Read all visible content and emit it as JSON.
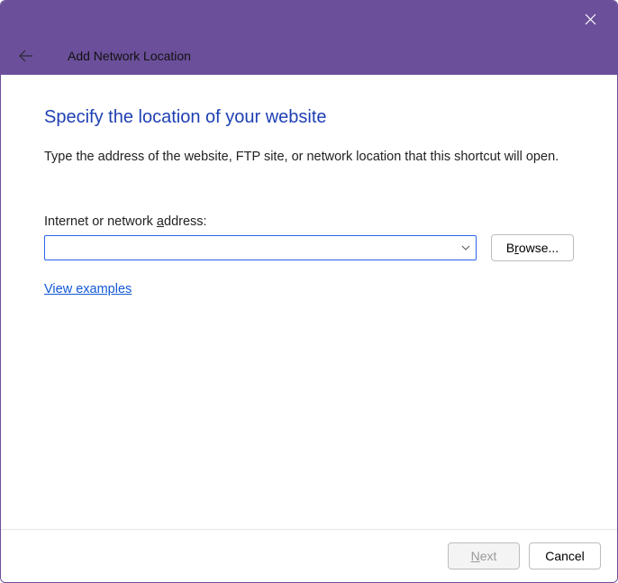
{
  "titlebar": {
    "close_label": "Close"
  },
  "header": {
    "back_label": "Back",
    "title": "Add Network Location"
  },
  "content": {
    "heading": "Specify the location of your website",
    "description": "Type the address of the website, FTP site, or network location that this shortcut will open.",
    "field_label_pre": "Internet or network ",
    "field_label_u": "a",
    "field_label_post": "ddress:",
    "address_value": "",
    "browse_pre": "B",
    "browse_u": "r",
    "browse_post": "owse...",
    "view_examples": "View examples"
  },
  "footer": {
    "next_u": "N",
    "next_post": "ext",
    "cancel": "Cancel"
  }
}
